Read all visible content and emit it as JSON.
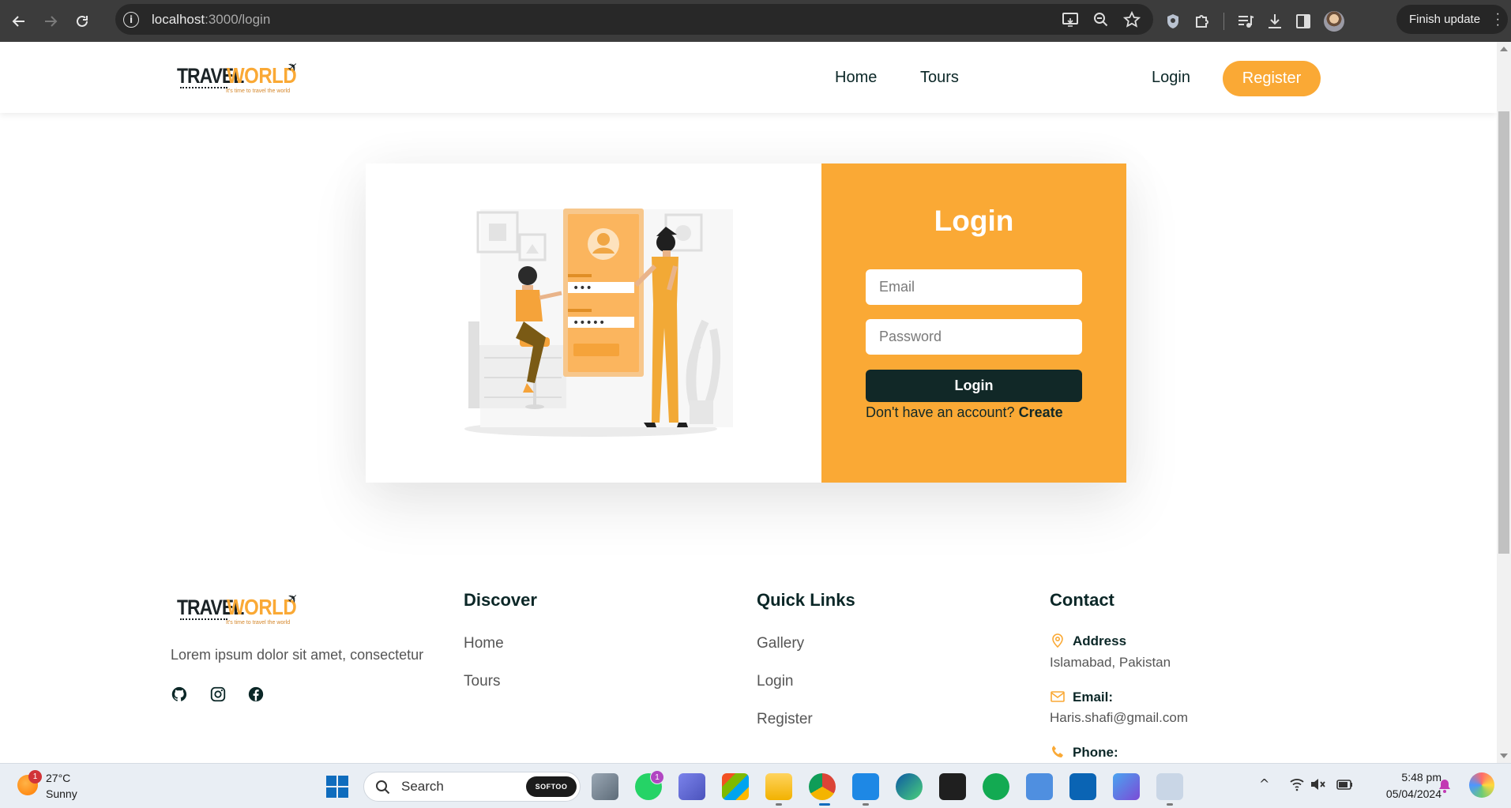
{
  "browser": {
    "url_host": "localhost",
    "url_path": ":3000/login",
    "finish_update_label": "Finish update"
  },
  "site": {
    "brand_main": "TRAVEL",
    "brand_accent": "WORLD",
    "brand_tagline": "It's time to travel the world",
    "nav": {
      "home": "Home",
      "tours": "Tours"
    },
    "login_link": "Login",
    "register_button": "Register",
    "accent_color": "#faa935",
    "dark_color": "#112827"
  },
  "login": {
    "title": "Login",
    "email_placeholder": "Email",
    "password_placeholder": "Password",
    "submit_label": "Login",
    "no_account_text": "Don't have an account?",
    "create_link": "Create"
  },
  "footer": {
    "description": "Lorem ipsum dolor sit amet, consectetur",
    "discover": {
      "heading": "Discover",
      "links": [
        "Home",
        "Tours"
      ]
    },
    "quick_links": {
      "heading": "Quick Links",
      "links": [
        "Gallery",
        "Login",
        "Register"
      ]
    },
    "contact": {
      "heading": "Contact",
      "address_label": "Address",
      "address_value": "Islamabad, Pakistan",
      "email_label": "Email:",
      "email_value": "Haris.shafi@gmail.com",
      "phone_label": "Phone:"
    },
    "social_icons": [
      "github-icon",
      "instagram-icon",
      "facebook-icon"
    ]
  },
  "taskbar": {
    "weather_temp": "27°C",
    "weather_condition": "Sunny",
    "weather_badge": "1",
    "search_label": "Search",
    "search_brand": "SOFTOO",
    "whatsapp_badge": "1",
    "clock_time": "5:48 pm",
    "clock_date": "05/04/2024"
  }
}
